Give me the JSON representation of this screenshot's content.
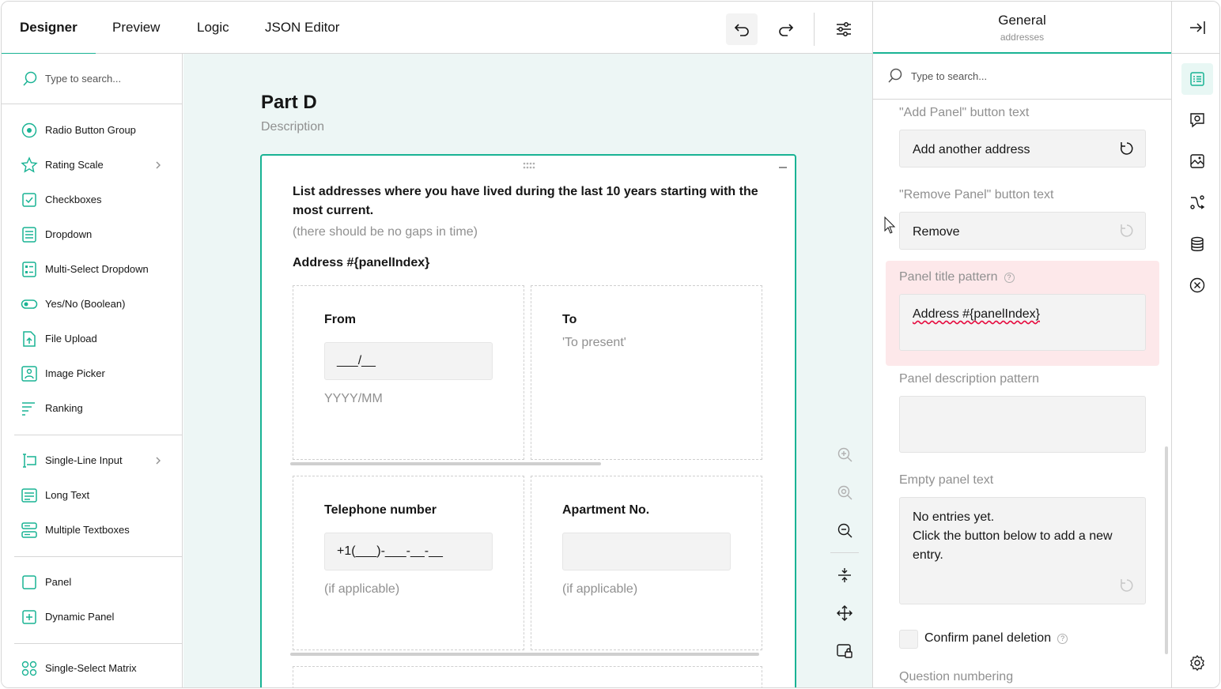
{
  "toolbar": {
    "tabs": [
      {
        "label": "Designer",
        "active": true
      },
      {
        "label": "Preview",
        "active": false
      },
      {
        "label": "Logic",
        "active": false
      },
      {
        "label": "JSON Editor",
        "active": false
      }
    ],
    "icons": [
      "undo-icon",
      "redo-icon",
      "settings-sliders-icon"
    ]
  },
  "toolbox": {
    "search_placeholder": "Type to search...",
    "items": [
      {
        "label": "Radio Button Group",
        "icon": "radio-icon"
      },
      {
        "label": "Rating Scale",
        "icon": "star-icon",
        "submenu": true
      },
      {
        "label": "Checkboxes",
        "icon": "checkbox-icon"
      },
      {
        "label": "Dropdown",
        "icon": "dropdown-icon"
      },
      {
        "label": "Multi-Select Dropdown",
        "icon": "tagbox-icon"
      },
      {
        "label": "Yes/No (Boolean)",
        "icon": "toggle-icon"
      },
      {
        "label": "File Upload",
        "icon": "file-upload-icon"
      },
      {
        "label": "Image Picker",
        "icon": "image-picker-icon"
      },
      {
        "label": "Ranking",
        "icon": "ranking-icon"
      },
      {
        "label": "Single-Line Input",
        "icon": "text-input-icon",
        "submenu": true
      },
      {
        "label": "Long Text",
        "icon": "comment-icon"
      },
      {
        "label": "Multiple Textboxes",
        "icon": "multiple-text-icon"
      },
      {
        "label": "Panel",
        "icon": "panel-icon"
      },
      {
        "label": "Dynamic Panel",
        "icon": "dynamic-panel-icon"
      },
      {
        "label": "Single-Select Matrix",
        "icon": "matrix-icon"
      }
    ]
  },
  "canvas": {
    "page_title": "Part D",
    "page_description": "Description",
    "question_title": "List addresses where you have lived during the last 10 years starting with the most current.",
    "question_description": "(there should be no gaps in time)",
    "panel_title": "Address #{panelIndex}",
    "cells": {
      "from": {
        "title": "From",
        "input_mask": "___/__",
        "help": "YYYY/MM"
      },
      "to": {
        "title": "To",
        "placeholder": "'To present'"
      },
      "phone": {
        "title": "Telephone number",
        "input_mask": "+1(___)-___-__-__",
        "help": "(if applicable)"
      },
      "apartment": {
        "title": "Apartment No.",
        "input_mask": "",
        "help": "(if applicable)"
      }
    },
    "zoom_tools": [
      "zoom-in-icon",
      "zoom-to-fit-icon",
      "zoom-out-icon",
      "collapse-all-icon",
      "expand-all-icon",
      "lock-question-icon"
    ]
  },
  "properties": {
    "header_title": "General",
    "header_subtitle": "addresses",
    "search_placeholder": "Type to search...",
    "add_panel_label": "\"Add Panel\" button text",
    "add_panel_value": "Add another address",
    "remove_panel_label": "\"Remove Panel\" button text",
    "remove_panel_value": "Remove",
    "title_pattern_label": "Panel title pattern",
    "title_pattern_value": "Address #{panelIndex}",
    "desc_pattern_label": "Panel description pattern",
    "desc_pattern_value": "",
    "empty_text_label": "Empty panel text",
    "empty_text_line1": "No entries yet.",
    "empty_text_line2": "Click the button below to add a new entry.",
    "confirm_delete_label": "Confirm panel deletion",
    "confirm_delete_checked": false,
    "question_numbering_label": "Question numbering"
  },
  "rail": {
    "icons": [
      "collapse-panel-icon",
      "general-properties-icon",
      "logo-in-survey-icon",
      "image-settings-icon",
      "logic-icon",
      "data-icon",
      "validation-icon",
      "global-settings-icon"
    ]
  },
  "colors": {
    "accent": "#19b394",
    "error_bg": "#fde8ea",
    "canvas_bg": "#edf6f5"
  }
}
